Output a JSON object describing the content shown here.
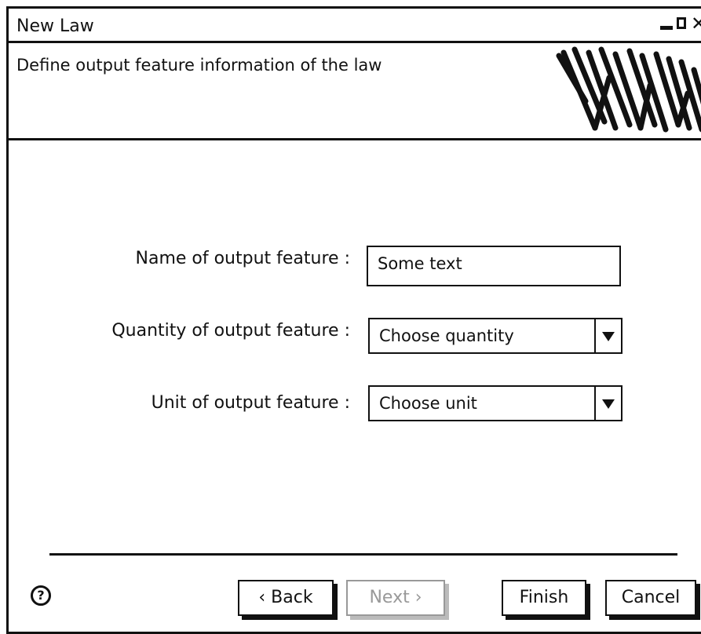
{
  "window": {
    "title": "New Law",
    "header_text": "Define output feature information of the law"
  },
  "form": {
    "name_label": "Name of output feature :",
    "name_value": "Some text",
    "quantity_label": "Quantity of output feature :",
    "quantity_value": "Choose quantity",
    "unit_label": "Unit of output feature :",
    "unit_value": "Choose unit"
  },
  "buttons": {
    "help": "?",
    "back": "‹ Back",
    "next": "Next ›",
    "finish": "Finish",
    "cancel": "Cancel"
  },
  "icons": [
    "minimize-icon",
    "maximize-icon",
    "close-icon",
    "scribble-logo",
    "help-icon"
  ]
}
